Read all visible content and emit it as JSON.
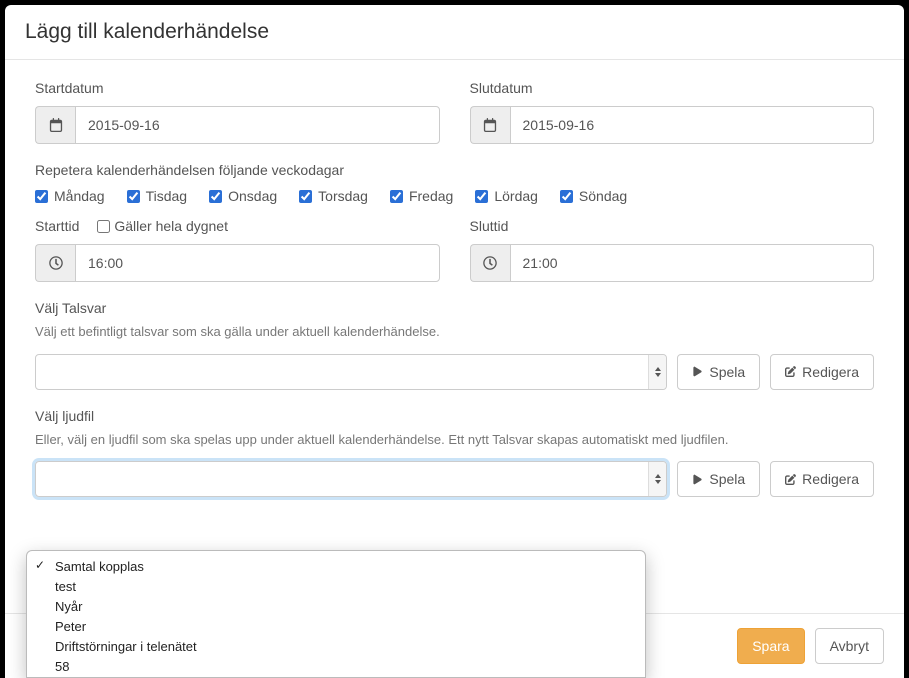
{
  "modal": {
    "title": "Lägg till kalenderhändelse"
  },
  "dates": {
    "start_label": "Startdatum",
    "start_value": "2015-09-16",
    "end_label": "Slutdatum",
    "end_value": "2015-09-16"
  },
  "repeat": {
    "label": "Repetera kalenderhändelsen följande veckodagar",
    "days": {
      "mon": "Måndag",
      "tue": "Tisdag",
      "wed": "Onsdag",
      "thu": "Torsdag",
      "fri": "Fredag",
      "sat": "Lördag",
      "sun": "Söndag"
    }
  },
  "times": {
    "start_label": "Starttid",
    "all_day_label": "Gäller hela dygnet",
    "start_value": "16:00",
    "end_label": "Sluttid",
    "end_value": "21:00"
  },
  "talsvar": {
    "label": "Välj Talsvar",
    "help": "Välj ett befintligt talsvar som ska gälla under aktuell kalenderhändelse.",
    "play": "Spela",
    "edit": "Redigera"
  },
  "audiofile": {
    "label": "Välj ljudfil",
    "help": "Eller, välj en ljudfil som ska spelas upp under aktuell kalenderhändelse. Ett nytt Talsvar skapas automatiskt med ljudfilen.",
    "play": "Spela",
    "edit": "Redigera"
  },
  "footer": {
    "save": "Spara",
    "cancel": "Avbryt"
  },
  "dropdown": {
    "items": [
      "",
      "Samtal kopplas",
      "test",
      "Nyår",
      "Peter",
      "Driftstörningar i telenätet",
      "58"
    ]
  }
}
